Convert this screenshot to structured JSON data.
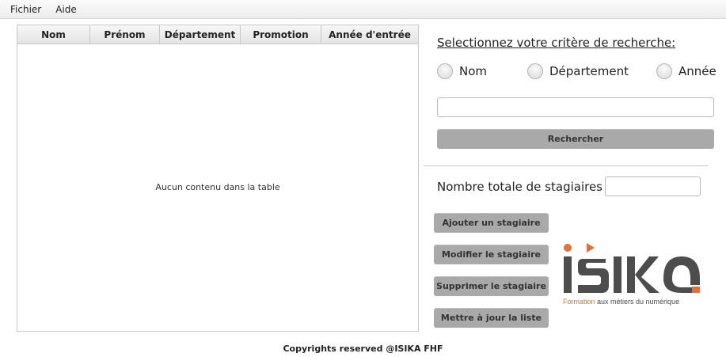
{
  "menu": {
    "items": [
      "Fichier",
      "Aide"
    ]
  },
  "table": {
    "columns": [
      "Nom",
      "Prénom",
      "Département",
      "Promotion",
      "Année d'entrée"
    ],
    "empty_text": "Aucun contenu dans la table"
  },
  "search": {
    "title": "Selectionnez votre critère de recherche:",
    "options": [
      "Nom",
      "Département",
      "Année"
    ],
    "input_value": "",
    "button_label": "Rechercher"
  },
  "total": {
    "label": "Nombre totale de stagiaires",
    "value": ""
  },
  "actions": {
    "add": "Ajouter un stagiaire",
    "edit": "Modifier le stagiaire",
    "delete": "Supprimer le stagiaire",
    "refresh": "Mettre à jour la liste"
  },
  "logo": {
    "word": "isika",
    "tagline_accent": "Formation",
    "tagline_rest": " aux métiers du numérique",
    "colors": {
      "dark": "#4d4d4d",
      "accent": "#e2703a"
    }
  },
  "footer": {
    "text": "Copyrights reserved @ISIKA FHF"
  }
}
